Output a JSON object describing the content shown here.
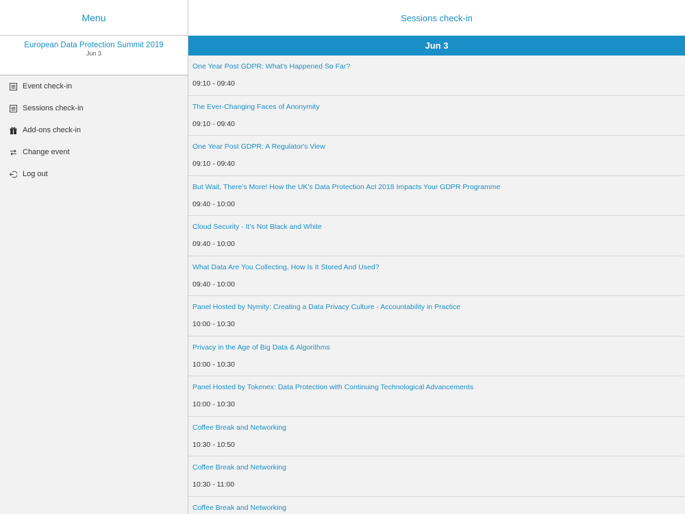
{
  "sidebar": {
    "title": "Menu",
    "event": {
      "name": "European Data Protection Summit 2019",
      "date": "Jun 3"
    },
    "items": [
      {
        "label": "Event check-in",
        "icon": "list-icon"
      },
      {
        "label": "Sessions check-in",
        "icon": "list-icon"
      },
      {
        "label": "Add-ons check-in",
        "icon": "gift-icon"
      },
      {
        "label": "Change event",
        "icon": "swap-icon"
      },
      {
        "label": "Log out",
        "icon": "logout-icon"
      }
    ]
  },
  "main": {
    "title": "Sessions check-in",
    "date_header": "Jun 3",
    "sessions": [
      {
        "title": "One Year Post GDPR: What's Happened So Far?",
        "time": "09:10 - 09:40"
      },
      {
        "title": "The Ever-Changing Faces of Anonymity",
        "time": "09:10 - 09:40"
      },
      {
        "title": "One Year Post GDPR: A Regulator's View",
        "time": "09:10 - 09:40"
      },
      {
        "title": "But Wait, There's More! How the UK's Data Protection Act 2018 Impacts Your GDPR Programme",
        "time": "09:40 - 10:00"
      },
      {
        "title": "Cloud Security - It's Not Black and White",
        "time": "09:40 - 10:00"
      },
      {
        "title": "What Data Are You Collecting, How Is It Stored And Used?",
        "time": "09:40 - 10:00"
      },
      {
        "title": "Panel Hosted by Nymity: Creating a Data Privacy Culture - Accountability in Practice",
        "time": "10:00 - 10:30"
      },
      {
        "title": "Privacy in the Age of Big Data & Algorithms",
        "time": "10:00 - 10:30"
      },
      {
        "title": "Panel Hosted by Tokenex: Data Protection with Continuing Technological Advancements",
        "time": "10:00 - 10:30"
      },
      {
        "title": "Coffee Break and Networking",
        "time": "10:30 - 10:50"
      },
      {
        "title": "Coffee Break and Networking",
        "time": "10:30 - 11:00"
      },
      {
        "title": "Coffee Break and Networking",
        "time": ""
      }
    ]
  },
  "colors": {
    "accent": "#1a8fc7",
    "panel_bg": "#f2f2f2"
  }
}
